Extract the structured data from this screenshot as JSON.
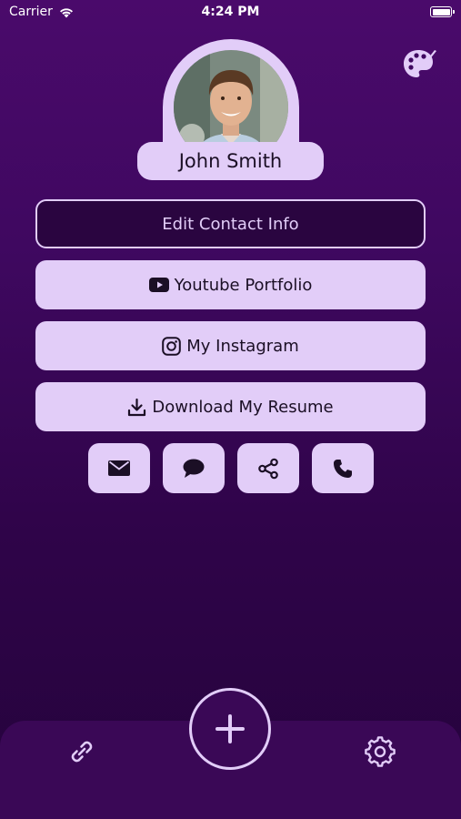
{
  "status_bar": {
    "carrier": "Carrier",
    "time": "4:24 PM",
    "wifi_icon": "wifi-icon",
    "battery_level": 1.0
  },
  "header": {
    "theme_icon": "palette-icon"
  },
  "profile": {
    "name": "John Smith",
    "avatar": "profile-photo"
  },
  "buttons": {
    "edit_contact": "Edit Contact Info",
    "youtube": "Youtube Portfolio",
    "instagram": "My Instagram",
    "resume": "Download My Resume"
  },
  "quick_actions": [
    {
      "icon": "mail-icon"
    },
    {
      "icon": "chat-icon"
    },
    {
      "icon": "share-icon"
    },
    {
      "icon": "phone-icon"
    }
  ],
  "tab_bar": {
    "left_icon": "link-icon",
    "center_icon": "plus-icon",
    "right_icon": "gear-icon"
  },
  "colors": {
    "accent": "#e2cdf8",
    "background_top": "#4a0a6b",
    "background_bottom": "#25033c",
    "tab_bar": "#3a0856",
    "text_dark": "#1b0f25"
  }
}
